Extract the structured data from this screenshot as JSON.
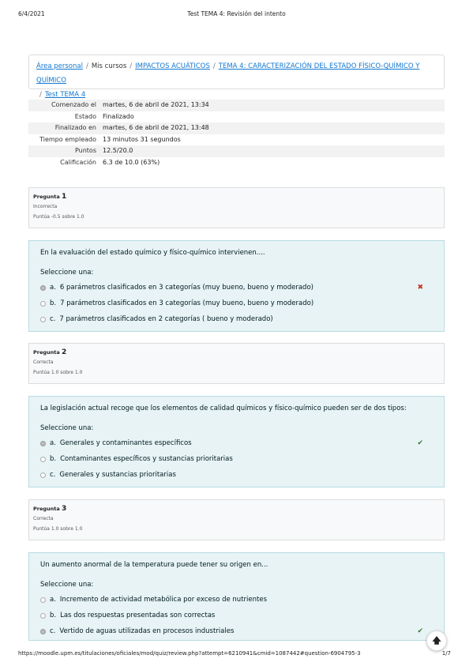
{
  "print": {
    "date": "6/4/2021",
    "title": "Test TEMA 4: Revisión del intento",
    "url": "https://moodle.upm.es/titulaciones/oficiales/mod/quiz/review.php?attempt=6210941&cmid=1087442#question-6904795-3",
    "page": "1/7"
  },
  "breadcrumb": {
    "items": [
      {
        "label": "Área personal",
        "link": true
      },
      {
        "label": "Mis cursos",
        "link": false
      },
      {
        "label": "IMPACTOS ACUÁTICOS",
        "link": true
      },
      {
        "label": "TEMA 4: CARACTERIZACIÓN DEL ESTADO FÍSICO-QUÍMICO Y QUÍMICO",
        "link": true
      },
      {
        "label": "Test TEMA 4",
        "link": true
      }
    ],
    "separator": "/"
  },
  "summary": [
    {
      "key": "Comenzado el",
      "value": "martes, 6 de abril de 2021, 13:34"
    },
    {
      "key": "Estado",
      "value": "Finalizado"
    },
    {
      "key": "Finalizado en",
      "value": "martes, 6 de abril de 2021, 13:48"
    },
    {
      "key": "Tiempo empleado",
      "value": "13 minutos 31 segundos"
    },
    {
      "key": "Puntos",
      "value": "12.5/20.0"
    },
    {
      "key": "Calificación",
      "value": "6.3 de 10.0 (63%)"
    }
  ],
  "questions": [
    {
      "label": "Pregunta",
      "number": "1",
      "state": "Incorrecta",
      "grade": "Puntúa -0.5 sobre 1.0",
      "text": "En la evaluación del estado químico y físico-químico intervienen....",
      "prompt": "Seleccione una:",
      "options": [
        {
          "letter": "a.",
          "text": "6 parámetros clasificados en 3 categorías (muy bueno, bueno y moderado)",
          "selected": true,
          "mark": "✖",
          "mark_type": "wrong"
        },
        {
          "letter": "b.",
          "text": "7 parámetros clasificados en 3 categorías (muy bueno, bueno y moderado)",
          "selected": false,
          "mark": "",
          "mark_type": ""
        },
        {
          "letter": "c.",
          "text": "7 parámetros clasificados en 2 categorías ( bueno y moderado)",
          "selected": false,
          "mark": "",
          "mark_type": ""
        }
      ]
    },
    {
      "label": "Pregunta",
      "number": "2",
      "state": "Correcta",
      "grade": "Puntúa 1.0 sobre 1.0",
      "text": "La legislación actual recoge que los elementos de calidad químicos y físico-químico pueden ser de dos tipos:",
      "prompt": "Seleccione una:",
      "options": [
        {
          "letter": "a.",
          "text": "Generales y contaminantes específicos",
          "selected": true,
          "mark": "✔",
          "mark_type": "right"
        },
        {
          "letter": "b.",
          "text": "Contaminantes específicos y sustancias prioritarias",
          "selected": false,
          "mark": "",
          "mark_type": ""
        },
        {
          "letter": "c.",
          "text": "Generales y sustancias prioritarias",
          "selected": false,
          "mark": "",
          "mark_type": ""
        }
      ]
    },
    {
      "label": "Pregunta",
      "number": "3",
      "state": "Correcta",
      "grade": "Puntúa 1.0 sobre 1.0",
      "text": "Un aumento anormal de la temperatura puede tener su origen en...",
      "prompt": "Seleccione una:",
      "options": [
        {
          "letter": "a.",
          "text": "Incremento de actividad metabólica por exceso de nutrientes",
          "selected": false,
          "mark": "",
          "mark_type": ""
        },
        {
          "letter": "b.",
          "text": "Las dos respuestas presentadas son correctas",
          "selected": false,
          "mark": "",
          "mark_type": ""
        },
        {
          "letter": "c.",
          "text": "Vertido de aguas utilizadas en procesos industriales",
          "selected": true,
          "mark": "✔",
          "mark_type": "right"
        }
      ]
    }
  ],
  "back_to_top": {
    "icon": "arrow-up-icon",
    "glyph": "🡅"
  }
}
